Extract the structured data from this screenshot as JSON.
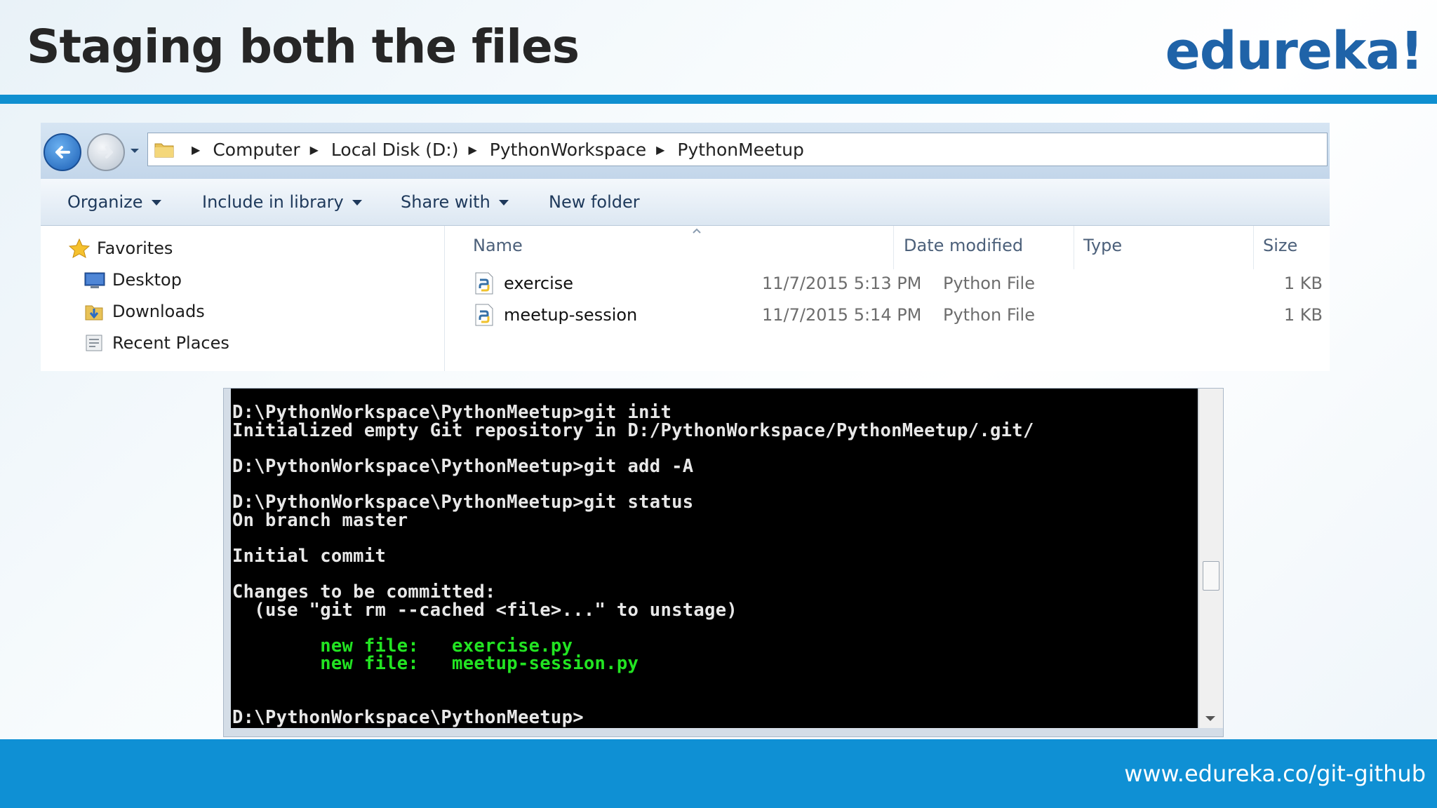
{
  "slide": {
    "title": "Staging both the files",
    "brand": "edureka!",
    "footer_url": "www.edureka.co/git-github"
  },
  "explorer": {
    "breadcrumb": [
      "Computer",
      "Local Disk (D:)",
      "PythonWorkspace",
      "PythonMeetup"
    ],
    "toolbar": {
      "organize": "Organize",
      "include": "Include in library",
      "share": "Share with",
      "new_folder": "New folder"
    },
    "nav": {
      "favorites": "Favorites",
      "desktop": "Desktop",
      "downloads": "Downloads",
      "recent": "Recent Places"
    },
    "columns": {
      "name": "Name",
      "date": "Date modified",
      "type": "Type",
      "size": "Size"
    },
    "files": [
      {
        "name": "exercise",
        "date": "11/7/2015 5:13 PM",
        "type": "Python File",
        "size": "1 KB"
      },
      {
        "name": "meetup-session",
        "date": "11/7/2015 5:14 PM",
        "type": "Python File",
        "size": "1 KB"
      }
    ]
  },
  "console": {
    "l1": "D:\\PythonWorkspace\\PythonMeetup>git init",
    "l2": "Initialized empty Git repository in D:/PythonWorkspace/PythonMeetup/.git/",
    "l3": "D:\\PythonWorkspace\\PythonMeetup>git add -A",
    "l4": "D:\\PythonWorkspace\\PythonMeetup>git status",
    "l5": "On branch master",
    "l6": "Initial commit",
    "l7": "Changes to be committed:",
    "l8": "  (use \"git rm --cached <file>...\" to unstage)",
    "l9": "        new file:   exercise.py",
    "l10": "        new file:   meetup-session.py",
    "l11": "D:\\PythonWorkspace\\PythonMeetup>"
  }
}
